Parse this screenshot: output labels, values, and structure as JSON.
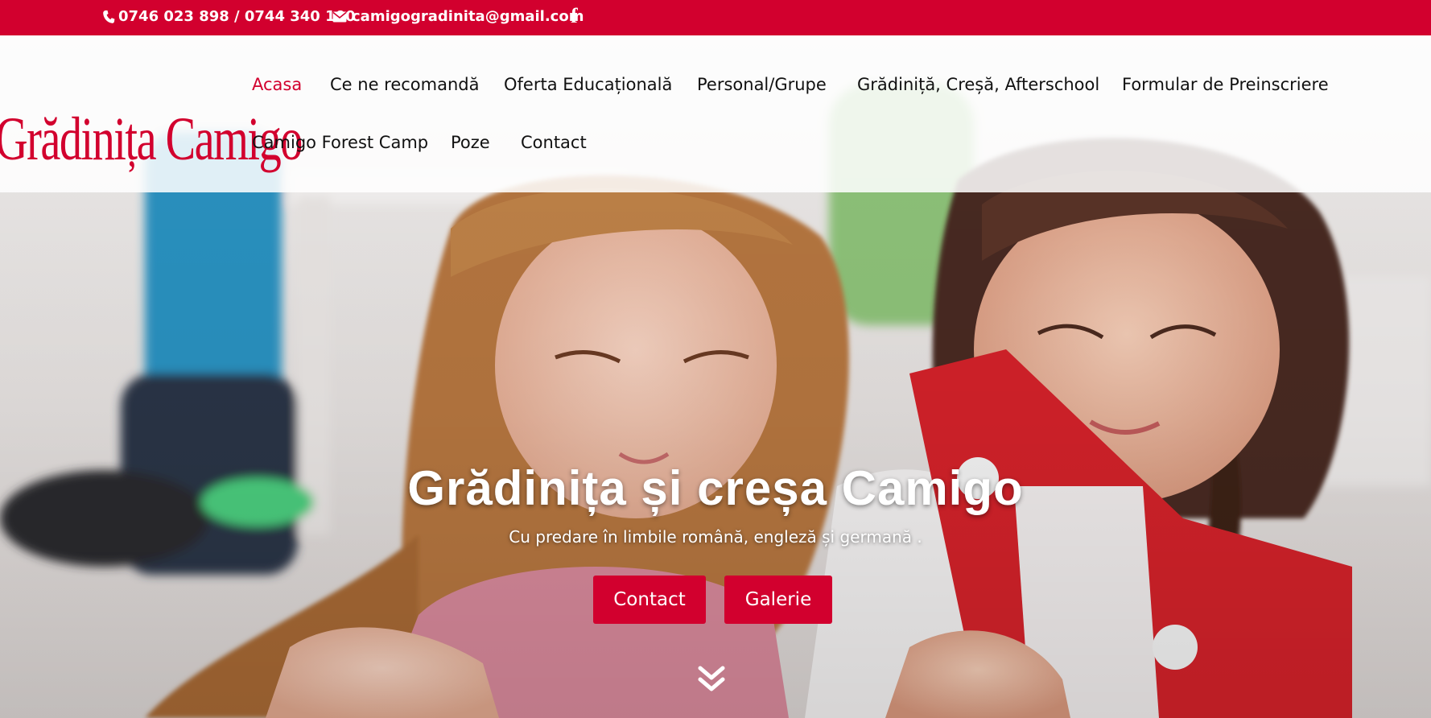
{
  "topbar": {
    "phone": "0746 023 898 / 0744 340 100",
    "email": "camigogradinita@gmail.com",
    "facebook_glyph": "f",
    "icons": [
      "phone-icon",
      "email-icon",
      "facebook-icon"
    ],
    "background": "#d2002e"
  },
  "logo": {
    "text": "Grădinița Camigo"
  },
  "nav": {
    "items": [
      {
        "label": "Acasa",
        "active": true
      },
      {
        "label": "Ce ne recomandă"
      },
      {
        "label": "Oferta Educațională"
      },
      {
        "label": "Personal/Grupe"
      },
      {
        "label": "Grădiniță, Creșă, Afterschool"
      },
      {
        "label": "Formular de Preinscriere"
      },
      {
        "label": "Camigo Forest Camp"
      },
      {
        "label": "Poze"
      },
      {
        "label": "Contact"
      }
    ]
  },
  "hero": {
    "title": "Grădinița și creșa Camigo",
    "subtitle": "Cu predare în limbile română, engleză și germană .",
    "buttons": {
      "contact": "Contact",
      "galerie": "Galerie"
    },
    "scroll_icon": "chevron-double-down-icon"
  },
  "colors": {
    "accent": "#d2002e",
    "text": "#111111",
    "white": "#ffffff"
  }
}
